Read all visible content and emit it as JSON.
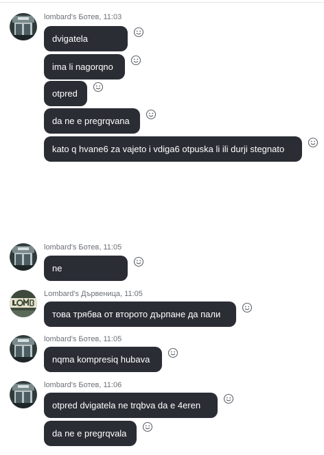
{
  "icons": {
    "avatar_botev": "store-photo-avatar",
    "avatar_darvenitsa": "lombard-sign-avatar",
    "reaction": "smiley-face-icon"
  },
  "colors": {
    "bubble_bg": "#2b2d35",
    "bubble_text": "#ffffff",
    "meta_text": "#6b6f76"
  },
  "groups": [
    {
      "meta": "lombard's Ботев, 11:03",
      "messages": [
        "dvigatela",
        "ima li nagorqno",
        "otpred",
        "da ne e pregrqvana",
        "kato q hvane6 za vajeto i vdiga6 otpuska li ili durji stegnato"
      ]
    },
    {
      "meta": "lombard's Ботев, 11:05",
      "messages": [
        "ne"
      ]
    },
    {
      "meta": "Lombard's Дървеница, 11:05",
      "messages": [
        "това трябва от второто дърпане да пали"
      ]
    },
    {
      "meta": "lombard's Ботев, 11:05",
      "messages": [
        "nqma kompresiq hubava"
      ]
    },
    {
      "meta": "lombard's Ботев, 11:06",
      "messages": [
        "otpred dvigatela ne trqbva da e 4eren",
        "da ne e pregrqvala"
      ]
    }
  ]
}
